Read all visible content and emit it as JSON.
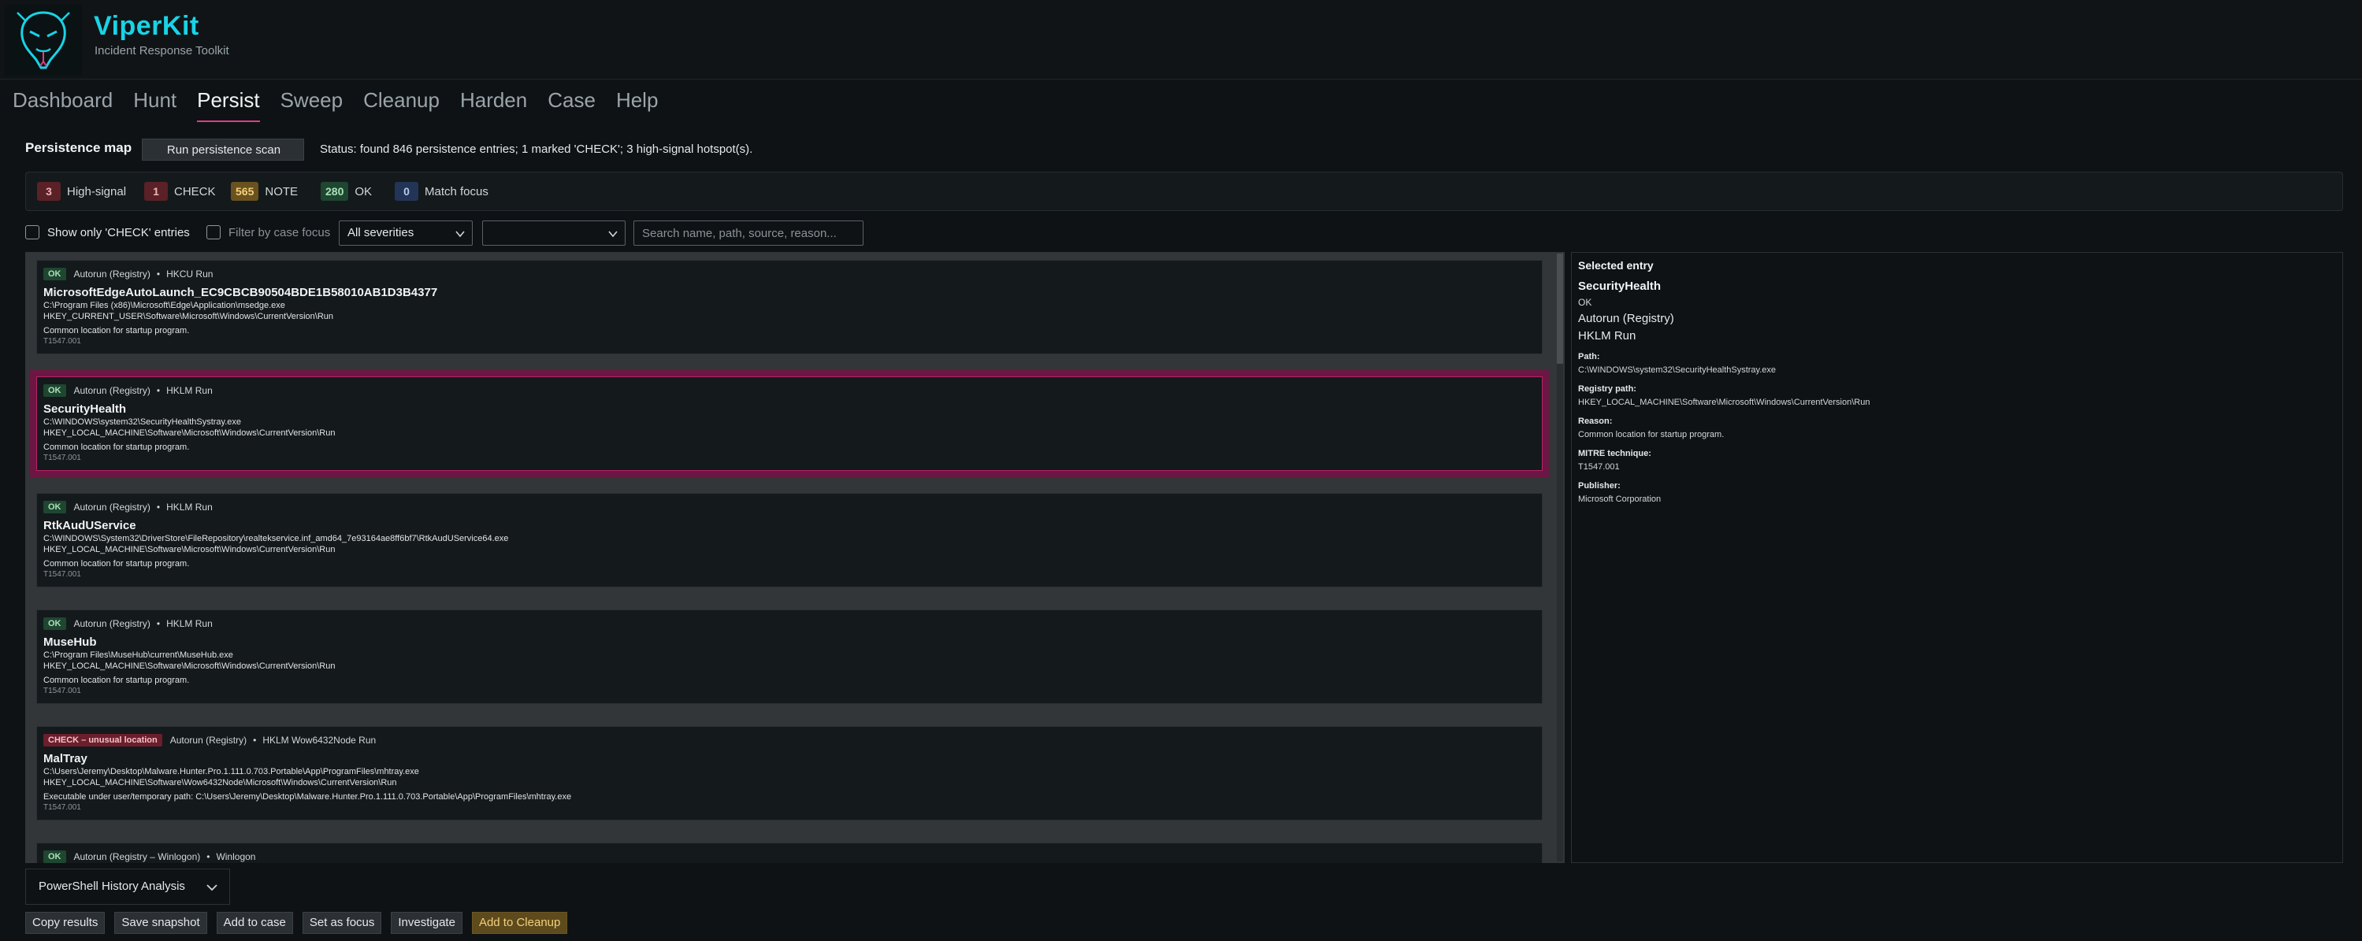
{
  "app": {
    "title": "ViperKit",
    "subtitle": "Incident Response Toolkit",
    "logo_icon": "viper-head-icon",
    "accent": "#19d3e6"
  },
  "nav": {
    "tabs": [
      {
        "label": "Dashboard"
      },
      {
        "label": "Hunt"
      },
      {
        "label": "Persist",
        "active": true
      },
      {
        "label": "Sweep"
      },
      {
        "label": "Cleanup"
      },
      {
        "label": "Harden"
      },
      {
        "label": "Case"
      },
      {
        "label": "Help"
      }
    ]
  },
  "toolbar": {
    "section_title": "Persistence map",
    "run_label": "Run persistence scan",
    "status": "Status: found 846 persistence entries; 1 marked 'CHECK'; 3 high-signal hotspot(s)."
  },
  "counters": [
    {
      "count": "3",
      "label": "High-signal",
      "color": "red"
    },
    {
      "count": "1",
      "label": "CHECK",
      "color": "red"
    },
    {
      "count": "565",
      "label": "NOTE",
      "color": "yellow"
    },
    {
      "count": "280",
      "label": "OK",
      "color": "green"
    },
    {
      "count": "0",
      "label": "Match focus",
      "color": "blue"
    }
  ],
  "filters": {
    "only_check_label": "Show only 'CHECK' entries",
    "focus_label": "Filter by case focus",
    "severity_selected": "All severities",
    "source_selected": "",
    "search_placeholder": "Search name, path, source, reason..."
  },
  "entries": [
    {
      "tag": "OK",
      "tag_type": "ok",
      "source": "Autorun (Registry)",
      "location": "HKCU Run",
      "name": "MicrosoftEdgeAutoLaunch_EC9CBCB90504BDE1B58010AB1D3B4377",
      "path": "C:\\Program Files (x86)\\Microsoft\\Edge\\Application\\msedge.exe",
      "registry": "HKEY_CURRENT_USER\\Software\\Microsoft\\Windows\\CurrentVersion\\Run",
      "reason": "Common location for startup program.",
      "mitre": "T1547.001"
    },
    {
      "tag": "OK",
      "tag_type": "ok",
      "source": "Autorun (Registry)",
      "location": "HKLM Run",
      "name": "SecurityHealth",
      "path": "C:\\WINDOWS\\system32\\SecurityHealthSystray.exe",
      "registry": "HKEY_LOCAL_MACHINE\\Software\\Microsoft\\Windows\\CurrentVersion\\Run",
      "reason": "Common location for startup program.",
      "mitre": "T1547.001",
      "selected": true
    },
    {
      "tag": "OK",
      "tag_type": "ok",
      "source": "Autorun (Registry)",
      "location": "HKLM Run",
      "name": "RtkAudUService",
      "path": "C:\\WINDOWS\\System32\\DriverStore\\FileRepository\\realtekservice.inf_amd64_7e93164ae8ff6bf7\\RtkAudUService64.exe",
      "registry": "HKEY_LOCAL_MACHINE\\Software\\Microsoft\\Windows\\CurrentVersion\\Run",
      "reason": "Common location for startup program.",
      "mitre": "T1547.001"
    },
    {
      "tag": "OK",
      "tag_type": "ok",
      "source": "Autorun (Registry)",
      "location": "HKLM Run",
      "name": "MuseHub",
      "path": "C:\\Program Files\\MuseHub\\current\\MuseHub.exe",
      "registry": "HKEY_LOCAL_MACHINE\\Software\\Microsoft\\Windows\\CurrentVersion\\Run",
      "reason": "Common location for startup program.",
      "mitre": "T1547.001"
    },
    {
      "tag": "CHECK – unusual location",
      "tag_type": "check",
      "source": "Autorun (Registry)",
      "location": "HKLM Wow6432Node Run",
      "name": "MalTray",
      "path": "C:\\Users\\Jeremy\\Desktop\\Malware.Hunter.Pro.1.111.0.703.Portable\\App\\ProgramFiles\\mhtray.exe",
      "registry": "HKEY_LOCAL_MACHINE\\Software\\Wow6432Node\\Microsoft\\Windows\\CurrentVersion\\Run",
      "reason": "Executable under user/temporary path: C:\\Users\\Jeremy\\Desktop\\Malware.Hunter.Pro.1.111.0.703.Portable\\App\\ProgramFiles\\mhtray.exe",
      "mitre": "T1547.001"
    },
    {
      "tag": "OK",
      "tag_type": "ok",
      "source": "Autorun (Registry – Winlogon)",
      "location": "Winlogon",
      "name": "",
      "path": "",
      "registry": "",
      "reason": "",
      "mitre": ""
    }
  ],
  "detail": {
    "title": "Selected entry",
    "name": "SecurityHealth",
    "severity": "OK",
    "source": "Autorun (Registry)",
    "location": "HKLM Run",
    "path_label": "Path:",
    "path": "C:\\WINDOWS\\system32\\SecurityHealthSystray.exe",
    "registry_label": "Registry path:",
    "registry": "HKEY_LOCAL_MACHINE\\Software\\Microsoft\\Windows\\CurrentVersion\\Run",
    "reason_label": "Reason:",
    "reason": "Common location for startup program.",
    "mitre_label": "MITRE technique:",
    "mitre": "T1547.001",
    "publisher_label": "Publisher:",
    "publisher": "Microsoft Corporation"
  },
  "preset": {
    "selected": "PowerShell History Analysis"
  },
  "actions": {
    "copy": "Copy results",
    "snapshot": "Save snapshot",
    "add_case": "Add to case",
    "focus": "Set as focus",
    "investigate": "Investigate",
    "cleanup": "Add to Cleanup"
  }
}
